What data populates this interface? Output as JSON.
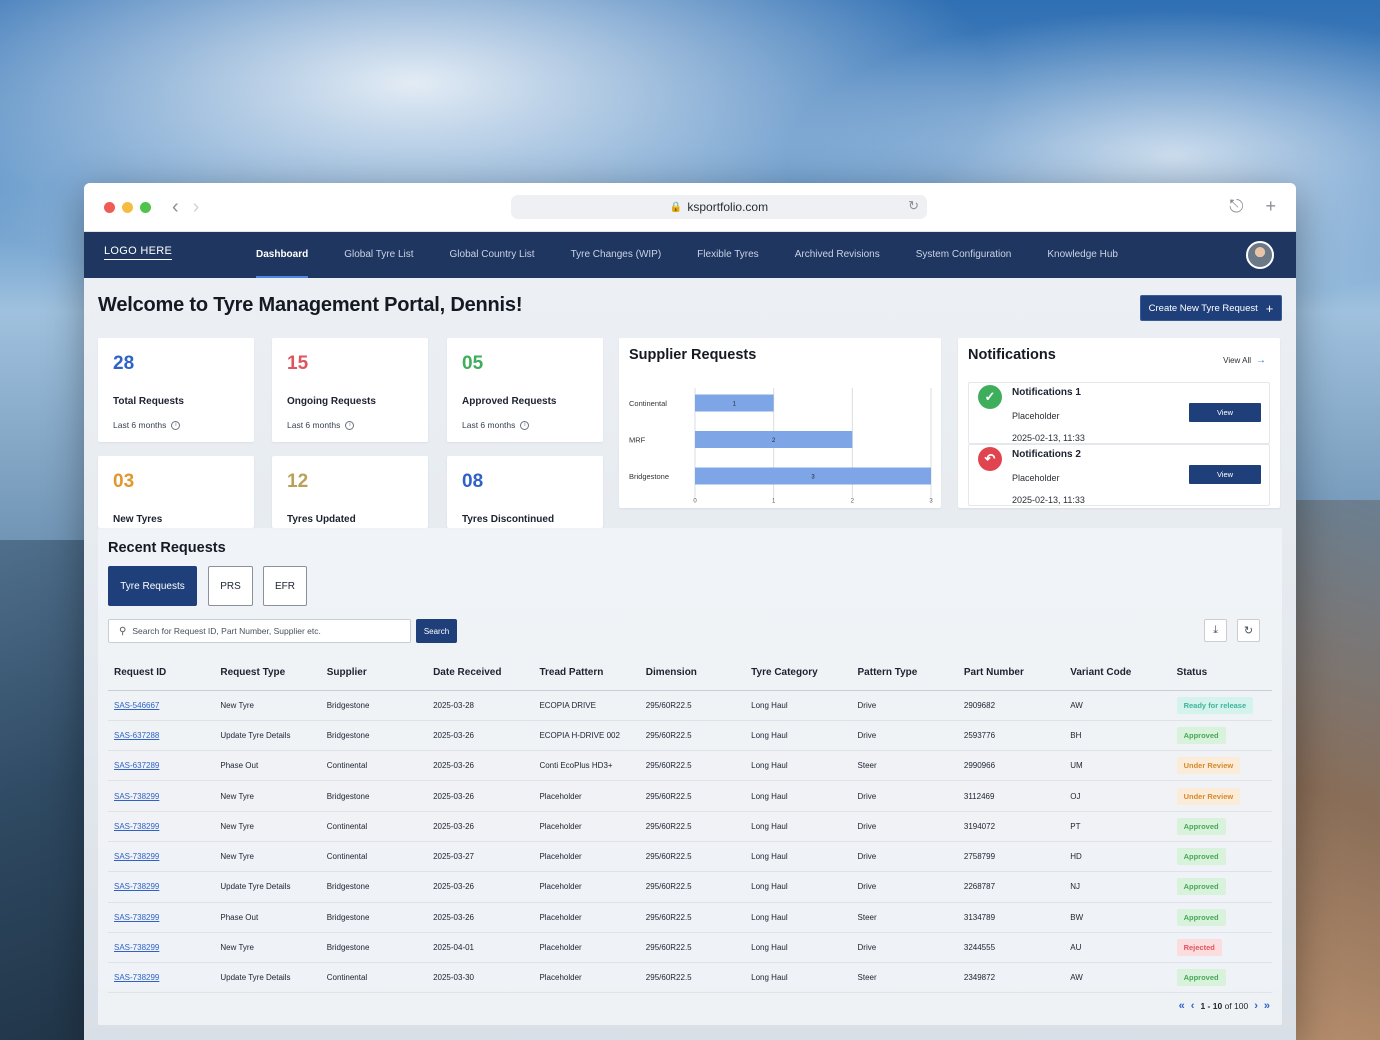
{
  "browser": {
    "url": "ksportfolio.com",
    "dot_colors": [
      "#ee5c55",
      "#f5bd3f",
      "#4fc34a"
    ]
  },
  "nav": {
    "logo": "LOGO HERE",
    "items": [
      {
        "label": "Dashboard",
        "active": true
      },
      {
        "label": "Global Tyre List"
      },
      {
        "label": "Global Country List"
      },
      {
        "label": "Tyre Changes (WIP)"
      },
      {
        "label": "Flexible Tyres"
      },
      {
        "label": "Archived Revisions"
      },
      {
        "label": "System Configuration"
      },
      {
        "label": "Knowledge Hub"
      }
    ]
  },
  "page": {
    "welcome": "Welcome to Tyre Management Portal, Dennis!",
    "create_button": "Create New Tyre Request"
  },
  "stats": [
    {
      "value": "28",
      "label": "Total Requests",
      "sub": "Last 6 months",
      "color": "#2f62c7"
    },
    {
      "value": "15",
      "label": "Ongoing Requests",
      "sub": "Last 6 months",
      "color": "#e0545f"
    },
    {
      "value": "05",
      "label": "Approved Requests",
      "sub": "Last 6 months",
      "color": "#3fae5c"
    },
    {
      "value": "03",
      "label": "New Tyres",
      "color": "#e2962e"
    },
    {
      "value": "12",
      "label": "Tyres Updated",
      "color": "#b9a15a"
    },
    {
      "value": "08",
      "label": "Tyres Discontinued",
      "color": "#2f62c7"
    }
  ],
  "supplier_panel": {
    "title": "Supplier Requests"
  },
  "chart_data": {
    "type": "bar",
    "orientation": "horizontal",
    "categories": [
      "Continental",
      "MRF",
      "Bridgestone"
    ],
    "values": [
      1,
      2,
      3
    ],
    "xlim": [
      0,
      3
    ],
    "xticks": [
      "0",
      "1",
      "2",
      "3"
    ],
    "bar_color": "#7ea5e6",
    "grid": true
  },
  "notifications": {
    "title": "Notifications",
    "view_all": "View All",
    "items": [
      {
        "title": "Notifications 1",
        "text": "Placeholder",
        "time": "2025-02-13, 11:33",
        "button": "View",
        "icon": "check-circle-icon",
        "color": "#3fae5c"
      },
      {
        "title": "Notifications 2",
        "text": "Placeholder",
        "time": "2025-02-13, 11:33",
        "button": "View",
        "icon": "return-arrow-icon",
        "color": "#e0454f"
      }
    ]
  },
  "recent": {
    "title": "Recent Requests",
    "tabs": [
      "Tyre Requests",
      "PRS",
      "EFR"
    ],
    "search_placeholder": "Search for Request ID, Part Number, Supplier etc.",
    "search_button": "Search",
    "columns": [
      "Request ID",
      "Request Type",
      "Supplier",
      "Date Received",
      "Tread Pattern",
      "Dimension",
      "Tyre Category",
      "Pattern Type",
      "Part Number",
      "Variant Code",
      "Status"
    ],
    "rows": [
      [
        "SAS-546667",
        "New Tyre",
        "Bridgestone",
        "2025-03-28",
        "ECOPIA DRIVE",
        "295/60R22.5",
        "Long Haul",
        "Drive",
        "2909682",
        "AW",
        "Ready for release"
      ],
      [
        "SAS-637288",
        "Update Tyre Details",
        "Bridgestone",
        "2025-03-26",
        "ECOPIA H-DRIVE 002",
        "295/60R22.5",
        "Long Haul",
        "Drive",
        "2593776",
        "BH",
        "Approved"
      ],
      [
        "SAS-637289",
        "Phase Out",
        "Continental",
        "2025-03-26",
        "Conti EcoPlus HD3+",
        "295/60R22.5",
        "Long Haul",
        "Steer",
        "2990966",
        "UM",
        "Under Review"
      ],
      [
        "SAS-738299",
        "New Tyre",
        "Bridgestone",
        "2025-03-26",
        "Placeholder",
        "295/60R22.5",
        "Long Haul",
        "Drive",
        "3112469",
        "OJ",
        "Under Review"
      ],
      [
        "SAS-738299",
        "New Tyre",
        "Continental",
        "2025-03-26",
        "Placeholder",
        "295/60R22.5",
        "Long Haul",
        "Drive",
        "3194072",
        "PT",
        "Approved"
      ],
      [
        "SAS-738299",
        "New Tyre",
        "Continental",
        "2025-03-27",
        "Placeholder",
        "295/60R22.5",
        "Long Haul",
        "Drive",
        "2758799",
        "HD",
        "Approved"
      ],
      [
        "SAS-738299",
        "Update Tyre Details",
        "Bridgestone",
        "2025-03-26",
        "Placeholder",
        "295/60R22.5",
        "Long Haul",
        "Drive",
        "2268787",
        "NJ",
        "Approved"
      ],
      [
        "SAS-738299",
        "Phase Out",
        "Bridgestone",
        "2025-03-26",
        "Placeholder",
        "295/60R22.5",
        "Long Haul",
        "Steer",
        "3134789",
        "BW",
        "Approved"
      ],
      [
        "SAS-738299",
        "New Tyre",
        "Bridgestone",
        "2025-04-01",
        "Placeholder",
        "295/60R22.5",
        "Long Haul",
        "Drive",
        "3244555",
        "AU",
        "Rejected"
      ],
      [
        "SAS-738299",
        "Update Tyre Details",
        "Continental",
        "2025-03-30",
        "Placeholder",
        "295/60R22.5",
        "Long Haul",
        "Steer",
        "2349872",
        "AW",
        "Approved"
      ]
    ],
    "pagination": {
      "range": "1 - 10",
      "of": "of 100"
    }
  }
}
